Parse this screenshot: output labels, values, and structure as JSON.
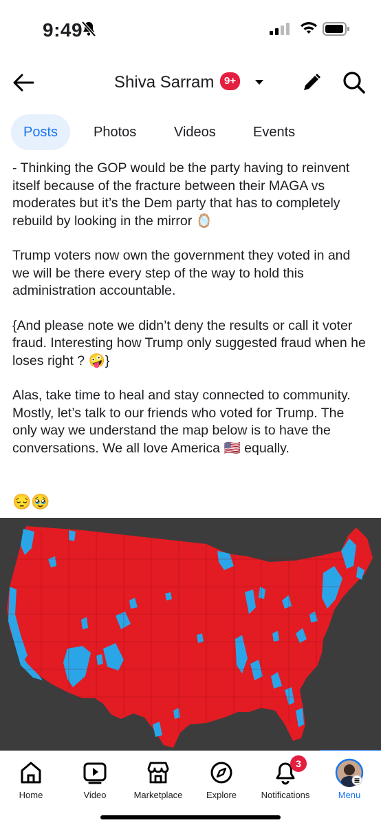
{
  "status": {
    "time": "9:49"
  },
  "header": {
    "title": "Shiva Sarram",
    "badge": "9+"
  },
  "tabs": [
    {
      "label": "Posts",
      "active": true
    },
    {
      "label": "Photos",
      "active": false
    },
    {
      "label": "Videos",
      "active": false
    },
    {
      "label": "Events",
      "active": false
    }
  ],
  "post": {
    "paragraphs": [
      "- Thinking the GOP would be the party having to reinvent itself because of the fracture between their MAGA vs moderates but it’s the Dem party that has to completely rebuild by looking in the mirror 🪞",
      "Trump voters now own the government they voted in and we will be there every step of the way to hold this administration accountable.",
      "{And please note we didn’t deny the results or call it voter fraud. Interesting how Trump only suggested fraud when he loses right ? 🤪}",
      "Alas, take time to heal and stay connected to community. Mostly, let’s talk to our friends who voted for Trump.  The only way we understand the map below is to have the conversations. We all love America 🇺🇸 equally."
    ],
    "emojis": "😔🥹"
  },
  "map": {
    "red": "#e31b23",
    "blue": "#2aa6e8",
    "background": "#3c3c3c"
  },
  "bottom_nav": [
    {
      "label": "Home",
      "icon": "home-icon"
    },
    {
      "label": "Video",
      "icon": "video-icon"
    },
    {
      "label": "Marketplace",
      "icon": "marketplace-icon"
    },
    {
      "label": "Explore",
      "icon": "compass-icon"
    },
    {
      "label": "Notifications",
      "icon": "bell-icon",
      "count": "3"
    },
    {
      "label": "Menu",
      "icon": "avatar-menu-icon",
      "active": true
    }
  ],
  "colors": {
    "accent": "#1877f2",
    "badge": "#e41e3f"
  }
}
